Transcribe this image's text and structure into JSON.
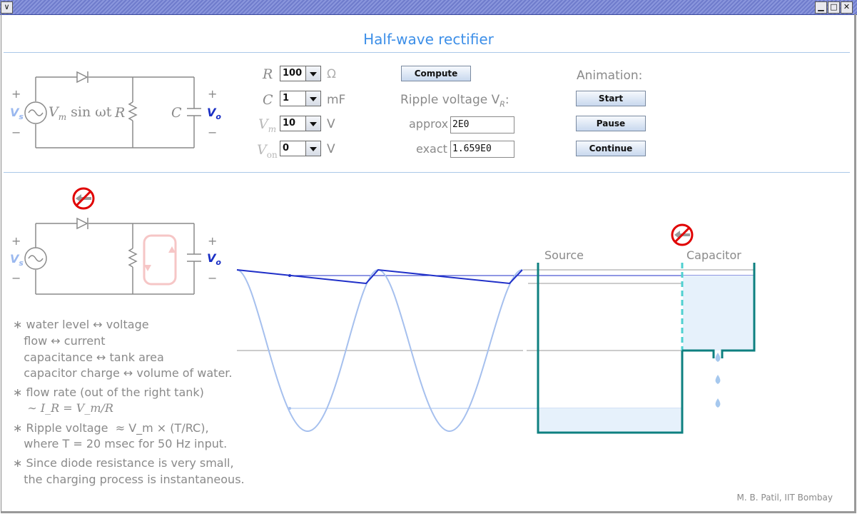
{
  "window": {
    "min_glyph": "▁",
    "max_glyph": "□",
    "close_glyph": "✕",
    "menu_glyph": "∨"
  },
  "title": "Half-wave rectifier",
  "circuit": {
    "plus": "+",
    "minus": "−",
    "vs_label": "V",
    "vs_sub": "s",
    "vo_label": "V",
    "vo_sub": "o",
    "source_expr": "V",
    "source_sub": "m",
    "source_rest": " sin ωt",
    "r_label": "R",
    "c_label": "C"
  },
  "params": {
    "r": {
      "label": "R",
      "value": "100",
      "unit": "Ω"
    },
    "c": {
      "label": "C",
      "value": "1",
      "unit": "mF"
    },
    "vm": {
      "label": "V",
      "sub": "m",
      "value": "10",
      "unit": "V"
    },
    "von": {
      "label": "V",
      "sub": "on",
      "value": "0",
      "unit": "V"
    }
  },
  "compute_label": "Compute",
  "ripple": {
    "heading": "Ripple voltage V",
    "heading_sub": "R",
    "heading_colon": ":",
    "approx_label": "approx",
    "approx_value": "2E0",
    "exact_label": "exact",
    "exact_value": "1.659E0"
  },
  "animation": {
    "heading": "Animation:",
    "start_label": "Start",
    "pause_label": "Pause",
    "continue_label": "Continue"
  },
  "tanks": {
    "source_label": "Source",
    "capacitor_label": "Capacitor"
  },
  "notes": [
    "∗ water level ↔ voltage",
    "   flow ↔ current",
    "   capacitance ↔ tank area",
    "   capacitor charge ↔ volume of water.",
    "∗ flow rate (out of the right tank)",
    "    ∼ I_R = V_m/R",
    "∗ Ripple voltage  ≈ V_m × (T/RC),",
    "   where T = 20 msec for 50 Hz input.",
    "∗ Since diode resistance is very small,",
    "   the charging process is instantaneous."
  ],
  "credit": "M. B. Patil, IIT Bombay",
  "colors": {
    "title": "#3d8fe8",
    "wire": "#8a8a8a",
    "vs": "#9ab8ef",
    "vo": "#1a2fc4",
    "sine": "#a6c0ee",
    "output": "#1f2fc8",
    "tank": "#0e8080",
    "water": "#e6f1fb",
    "no_symbol": "#e00000"
  },
  "icons": {
    "diode": "diode-icon",
    "no_reverse": "no-reverse-flow-icon",
    "drop": "water-drop-icon"
  }
}
